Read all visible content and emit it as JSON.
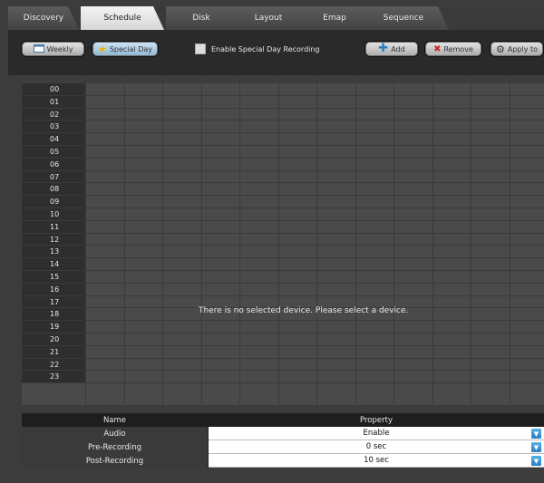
{
  "tabs": [
    {
      "label": "Discovery",
      "active": false
    },
    {
      "label": "Schedule",
      "active": true
    },
    {
      "label": "Disk",
      "active": false
    },
    {
      "label": "Layout",
      "active": false
    },
    {
      "label": "Emap",
      "active": false
    },
    {
      "label": "Sequence",
      "active": false
    }
  ],
  "toolbar": {
    "weekly_label": "Weekly",
    "special_day_label": "Special Day",
    "enable_special_day_label": "Enable Special Day Recording",
    "enable_special_day_checked": false,
    "add_label": "Add",
    "remove_label": "Remove",
    "apply_label": "Apply to"
  },
  "grid": {
    "hours": [
      "00",
      "01",
      "02",
      "03",
      "04",
      "05",
      "06",
      "07",
      "08",
      "09",
      "10",
      "11",
      "12",
      "13",
      "14",
      "15",
      "16",
      "17",
      "18",
      "19",
      "20",
      "21",
      "22",
      "23"
    ],
    "message": "There is no selected device. Please select a device."
  },
  "properties": {
    "header_name": "Name",
    "header_property": "Property",
    "rows": [
      {
        "name": "Audio",
        "value": "Enable"
      },
      {
        "name": "Pre-Recording",
        "value": "0 sec"
      },
      {
        "name": "Post-Recording",
        "value": "10 sec"
      }
    ]
  },
  "colors": {
    "background": "#3c3c3c",
    "grid_cell": "#4a4a4a",
    "accent": "#2a7fc0"
  }
}
